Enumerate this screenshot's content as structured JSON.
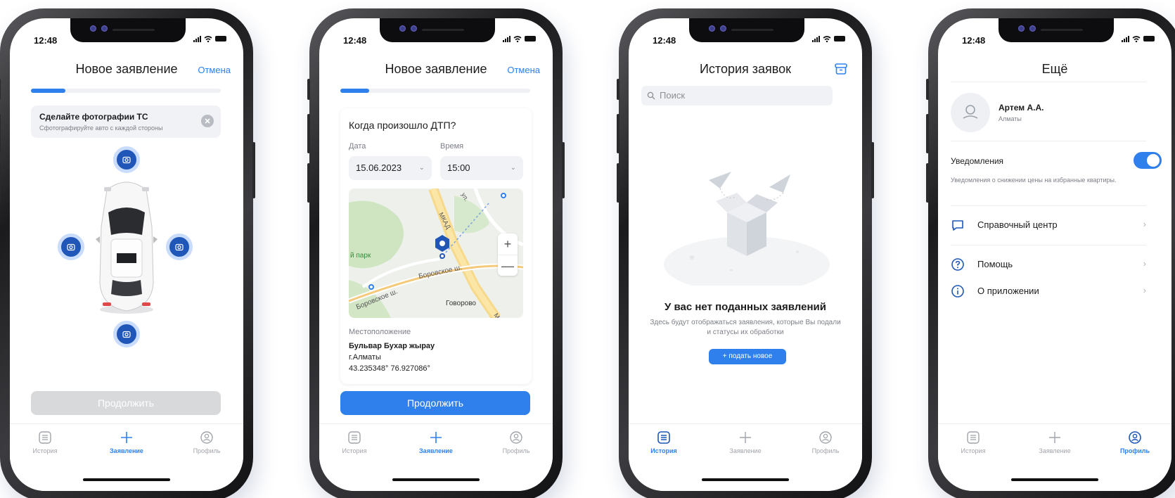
{
  "status_time": "12:48",
  "colors": {
    "accent": "#2f80ed",
    "camera_button": "#1f56b7",
    "disabled_button": "#d8d9db"
  },
  "tabs": {
    "history": "История",
    "application": "Заявление",
    "profile": "Профиль"
  },
  "icons": {
    "history": "list-icon",
    "application": "plus-icon",
    "profile": "user-circle-icon",
    "camera": "camera-icon",
    "archive": "archive-icon",
    "help_center": "chat-bubble-icon",
    "help": "question-circle-icon",
    "about": "info-circle-icon"
  },
  "screen1": {
    "title": "Новое заявление",
    "cancel": "Отмена",
    "progress": 0.18,
    "hint_title": "Сделайте фотографии ТС",
    "hint_subtitle": "Сфотографируйте авто с каждой стороны",
    "continue": "Продолжить",
    "active_tab": "application"
  },
  "screen2": {
    "title": "Новое заявление",
    "cancel": "Отмена",
    "progress": 0.15,
    "question": "Когда произошло ДТП?",
    "date_label": "Дата",
    "date_value": "15.06.2023",
    "time_label": "Время",
    "time_value": "15:00",
    "map_labels": {
      "park": "й парк",
      "road1": "Боровское ш.",
      "road2": "Боровское ш.",
      "town": "Говорово",
      "ring": "МКАД",
      "street": "ул.",
      "m": "М"
    },
    "zoom_in": "+",
    "zoom_out": "—",
    "location_label": "Местоположение",
    "street": "Бульвар Бухар жырау",
    "city": "г.Алматы",
    "coords": "43.235348° 76.927086°",
    "continue": "Продолжить",
    "active_tab": "application"
  },
  "screen3": {
    "title": "История заявок",
    "search_placeholder": "Поиск",
    "empty_title": "У вас нет поданных заявлений",
    "empty_subtitle": "Здесь будут отображаться заявления, которые Вы подали и статусы их обработки",
    "new_button": "+ подать новое",
    "active_tab": "history"
  },
  "screen4": {
    "title": "Ещё",
    "user_name": "Артем А.А.",
    "user_city": "Алматы",
    "notifications_label": "Уведомления",
    "notifications_desc": "Уведомления о снижении цены на избранные квартиры.",
    "notifications_on": true,
    "menu": [
      "Справочный центр",
      "Помощь",
      "О приложении"
    ],
    "active_tab": "profile"
  }
}
